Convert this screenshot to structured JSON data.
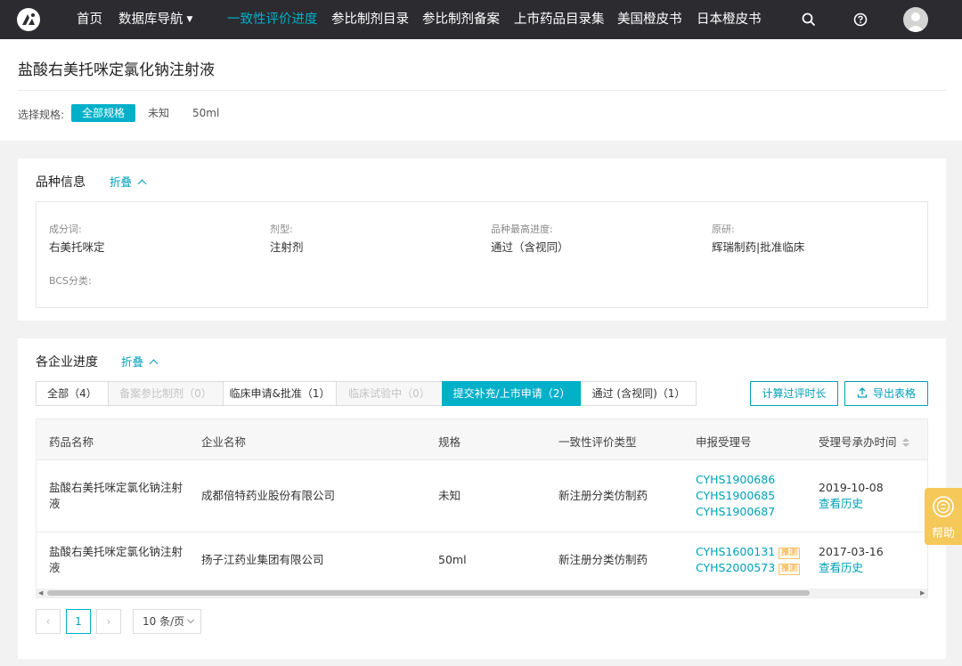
{
  "nav": {
    "items": [
      {
        "label": "首页"
      },
      {
        "label": "数据库导航"
      },
      {
        "label": "一致性评价进度"
      },
      {
        "label": "参比制剂目录"
      },
      {
        "label": "参比制剂备案"
      },
      {
        "label": "上市药品目录集"
      },
      {
        "label": "美国橙皮书"
      },
      {
        "label": "日本橙皮书"
      }
    ],
    "active_index": 2,
    "icons": [
      "logo-icon",
      "search-icon",
      "help-circle-icon",
      "avatar"
    ]
  },
  "header": {
    "title": "盐酸右美托咪定氯化钠注射液",
    "spec_label": "选择规格:",
    "spec_options": [
      "全部规格",
      "未知",
      "50ml"
    ],
    "spec_selected": 0
  },
  "variety": {
    "title": "品种信息",
    "fold_label": "折叠",
    "fields": [
      {
        "label": "成分词:",
        "value": "右美托咪定"
      },
      {
        "label": "剂型:",
        "value": "注射剂"
      },
      {
        "label": "品种最高进度:",
        "value": "通过（含视同）"
      },
      {
        "label": "原研:",
        "value": "辉瑞制药|批准临床"
      },
      {
        "label": "BCS分类:",
        "value": ""
      }
    ]
  },
  "progress": {
    "title": "各企业进度",
    "fold_label": "折叠",
    "tabs": [
      {
        "label": "全部（4）",
        "state": "normal"
      },
      {
        "label": "备案参比制剂（0）",
        "state": "disabled"
      },
      {
        "label": "临床申请&批准（1）",
        "state": "normal"
      },
      {
        "label": "临床试验中（0）",
        "state": "disabled"
      },
      {
        "label": "提交补充/上市申请（2）",
        "state": "active"
      },
      {
        "label": "通过 (含视同)（1）",
        "state": "normal"
      }
    ],
    "buttons": {
      "calc": "计算过评时长",
      "export": "导出表格"
    },
    "columns": [
      "药品名称",
      "企业名称",
      "规格",
      "一致性评价类型",
      "申报受理号",
      "受理号承办时间"
    ],
    "rows": [
      {
        "drug_name": "盐酸右美托咪定氯化钠注射液",
        "company": "成都倍特药业股份有限公司",
        "spec": "未知",
        "type": "新注册分类仿制药",
        "accept_nos": [
          {
            "no": "CYHS1900686",
            "tag": ""
          },
          {
            "no": "CYHS1900685",
            "tag": ""
          },
          {
            "no": "CYHS1900687",
            "tag": ""
          }
        ],
        "date": "2019-10-08",
        "history": "查看历史"
      },
      {
        "drug_name": "盐酸右美托咪定氯化钠注射液",
        "company": "扬子江药业集团有限公司",
        "spec": "50ml",
        "type": "新注册分类仿制药",
        "accept_nos": [
          {
            "no": "CYHS1600131",
            "tag": "推测"
          },
          {
            "no": "CYHS2000573",
            "tag": "推测"
          }
        ],
        "date": "2017-03-16",
        "history": "查看历史"
      }
    ]
  },
  "pagination": {
    "prev": "‹",
    "current": "1",
    "next": "›",
    "page_size": "10 条/页"
  },
  "help": {
    "label": "帮助"
  },
  "colors": {
    "accent": "#00b0c8",
    "nav_bg": "#2b2b30",
    "help_bg": "#f5c85a"
  }
}
